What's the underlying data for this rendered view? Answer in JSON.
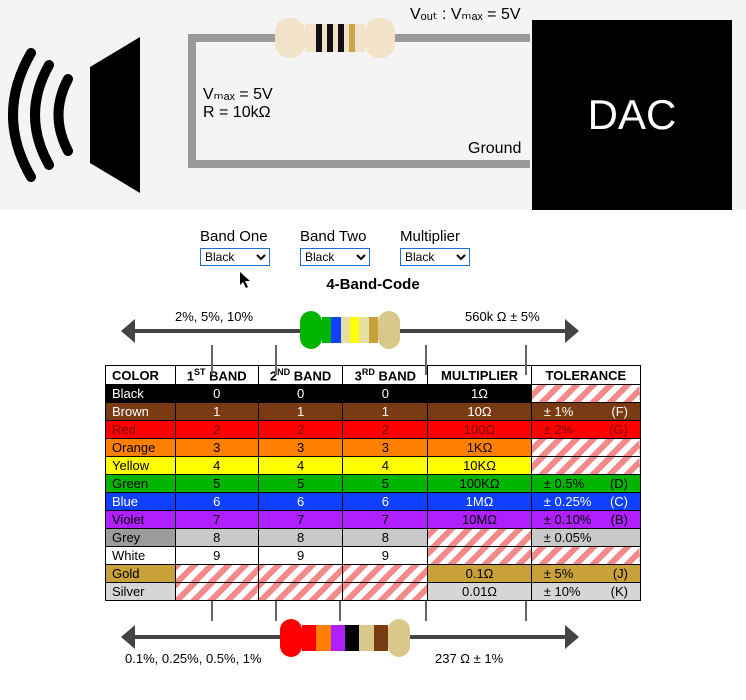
{
  "circuit": {
    "vout_label": "Vₒᵤₜ : Vₘₐₓ = 5V",
    "vmax": "Vₘₐₓ = 5V",
    "r_value": "R = 10kΩ",
    "ground": "Ground",
    "dac": "DAC"
  },
  "controls": {
    "band1_label": "Band One",
    "band2_label": "Band Two",
    "mult_label": "Multiplier",
    "band1_value": "Black",
    "band2_value": "Black",
    "mult_value": "Black"
  },
  "chart": {
    "title": "4-Band-Code",
    "top_left_label": "2%, 5%, 10%",
    "top_right_label": "560k Ω  ± 5%",
    "bottom_left_label": "0.1%, 0.25%, 0.5%, 1%",
    "bottom_right_label": "237 Ω  ± 1%",
    "headers": {
      "color": "COLOR",
      "b1": "1ST BAND",
      "b2": "2ND BAND",
      "b3": "3RD BAND",
      "mult": "MULTIPLIER",
      "tol": "TOLERANCE"
    },
    "rows": [
      {
        "name": "Black",
        "b1": "0",
        "b2": "0",
        "b3": "0",
        "mult": "1Ω",
        "tol": "",
        "code": "",
        "bg": "#000000",
        "fg": "#ffffff",
        "namebg": "#000000",
        "namefg": "#ffffff",
        "tolhatch": true
      },
      {
        "name": "Brown",
        "b1": "1",
        "b2": "1",
        "b3": "1",
        "mult": "10Ω",
        "tol": "± 1%",
        "code": "(F)",
        "bg": "#7a3b14",
        "fg": "#ffffff",
        "namebg": "#7a3b14",
        "namefg": "#ffffff"
      },
      {
        "name": "Red",
        "b1": "2",
        "b2": "2",
        "b3": "2",
        "mult": "100Ω",
        "tol": "± 2%",
        "code": "(G)",
        "bg": "#ff0000",
        "fg": "#7a0000",
        "namebg": "#ff0000",
        "namefg": "#7a0000"
      },
      {
        "name": "Orange",
        "b1": "3",
        "b2": "3",
        "b3": "3",
        "mult": "1KΩ",
        "tol": "",
        "code": "",
        "bg": "#ff7f00",
        "fg": "#000000",
        "namebg": "#ff7f00",
        "namefg": "#000000",
        "tolhatch": true
      },
      {
        "name": "Yellow",
        "b1": "4",
        "b2": "4",
        "b3": "4",
        "mult": "10KΩ",
        "tol": "",
        "code": "",
        "bg": "#ffff00",
        "fg": "#000000",
        "namebg": "#ffff00",
        "namefg": "#000000",
        "tolhatch": true
      },
      {
        "name": "Green",
        "b1": "5",
        "b2": "5",
        "b3": "5",
        "mult": "100KΩ",
        "tol": "± 0.5%",
        "code": "(D)",
        "bg": "#00b400",
        "fg": "#000000",
        "namebg": "#00b400",
        "namefg": "#000000"
      },
      {
        "name": "Blue",
        "b1": "6",
        "b2": "6",
        "b3": "6",
        "mult": "1MΩ",
        "tol": "± 0.25%",
        "code": "(C)",
        "bg": "#1040ff",
        "fg": "#ffffff",
        "namebg": "#1040ff",
        "namefg": "#ffffff"
      },
      {
        "name": "Violet",
        "b1": "7",
        "b2": "7",
        "b3": "7",
        "mult": "10MΩ",
        "tol": "± 0.10%",
        "code": "(B)",
        "bg": "#b020ff",
        "fg": "#000000",
        "namebg": "#b020ff",
        "namefg": "#000000"
      },
      {
        "name": "Grey",
        "b1": "8",
        "b2": "8",
        "b3": "8",
        "mult": "",
        "tol": "± 0.05%",
        "code": "",
        "bg": "#c9c9c9",
        "fg": "#000000",
        "namebg": "#9c9c9c",
        "namefg": "#000000",
        "multhatch": true
      },
      {
        "name": "White",
        "b1": "9",
        "b2": "9",
        "b3": "9",
        "mult": "",
        "tol": "",
        "code": "",
        "bg": "#ffffff",
        "fg": "#000000",
        "namebg": "#ffffff",
        "namefg": "#000000",
        "multhatch": true,
        "tolhatch": true
      },
      {
        "name": "Gold",
        "b1": "",
        "b2": "",
        "b3": "",
        "mult": "0.1Ω",
        "tol": "± 5%",
        "code": "(J)",
        "bg": "#c9a13b",
        "fg": "#000000",
        "namebg": "#c9a13b",
        "namefg": "#000000",
        "b1hatch": true,
        "b2hatch": true,
        "b3hatch": true
      },
      {
        "name": "Silver",
        "b1": "",
        "b2": "",
        "b3": "",
        "mult": "0.01Ω",
        "tol": "± 10%",
        "code": "(K)",
        "bg": "#d6d6d6",
        "fg": "#000000",
        "namebg": "#d6d6d6",
        "namefg": "#000000",
        "b1hatch": true,
        "b2hatch": true,
        "b3hatch": true
      }
    ]
  }
}
